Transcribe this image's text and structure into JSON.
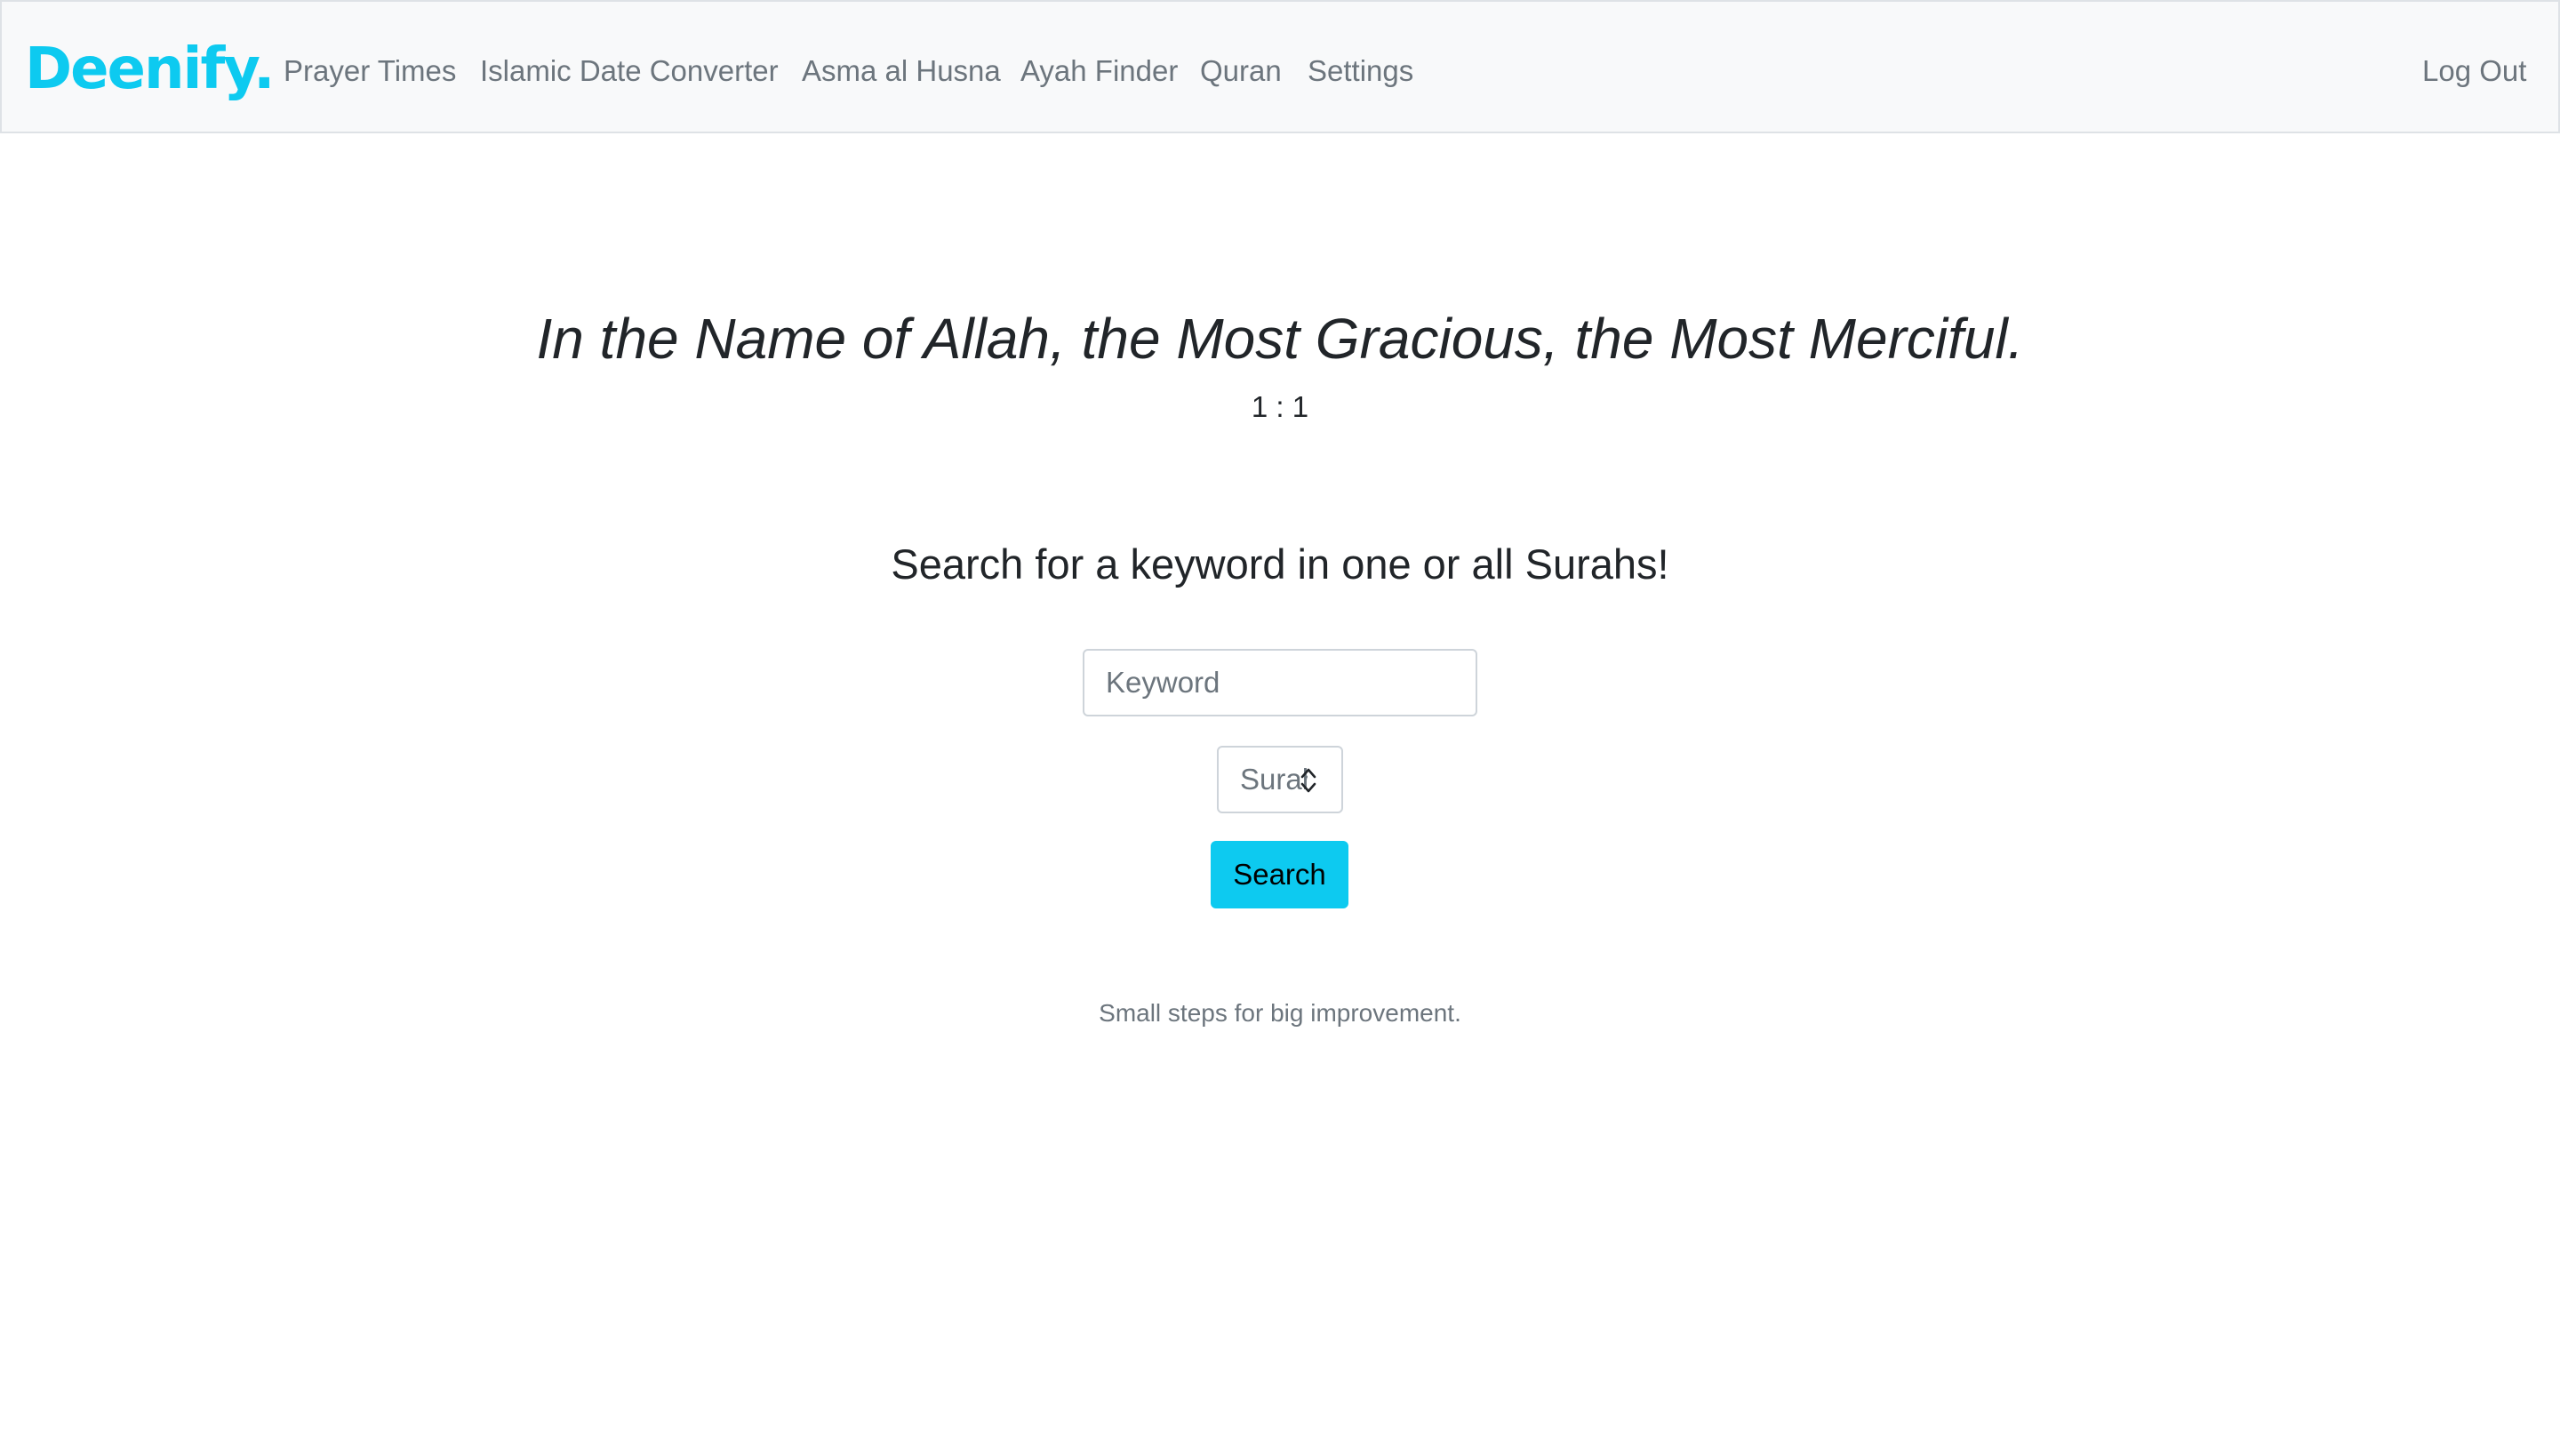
{
  "navbar": {
    "brand": "Deenify.",
    "links": [
      {
        "label": "Prayer Times"
      },
      {
        "label": "Islamic Date Converter"
      },
      {
        "label": "Asma al Husna"
      },
      {
        "label": "Ayah Finder"
      },
      {
        "label": "Quran"
      },
      {
        "label": "Settings"
      }
    ],
    "logout_label": "Log Out"
  },
  "verse": {
    "text": "In the Name of Allah, the Most Gracious, the Most Merciful.",
    "reference": "1 : 1"
  },
  "search": {
    "heading": "Search for a keyword in one or all Surahs!",
    "keyword_placeholder": "Keyword",
    "keyword_value": "",
    "surah_placeholder": "Surah",
    "surah_value": "",
    "button_label": "Search"
  },
  "footer": {
    "tagline": "Small steps for big improvement."
  },
  "colors": {
    "brand": "#0dcaf0",
    "button": "#0dcaf0",
    "navbar_bg": "#f8f9fa",
    "nav_text": "#6c757d"
  },
  "icons": {
    "surah_stepper": "up-down-spinner-icon"
  }
}
